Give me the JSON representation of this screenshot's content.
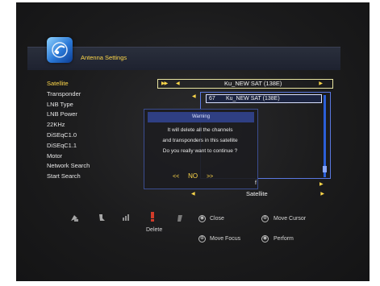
{
  "window": {
    "title": "Antenna Settings"
  },
  "menu": [
    {
      "label": "Satellite",
      "active": true
    },
    {
      "label": "Transponder",
      "active": false
    },
    {
      "label": "LNB Type",
      "active": false
    },
    {
      "label": "LNB Power",
      "active": false
    },
    {
      "label": "22KHz",
      "active": false
    },
    {
      "label": "DiSEqC1.0",
      "active": false
    },
    {
      "label": "DiSEqC1.1",
      "active": false
    },
    {
      "label": "Motor",
      "active": false
    },
    {
      "label": "Network Search",
      "active": false
    },
    {
      "label": "Start Search",
      "active": false
    }
  ],
  "satellite": {
    "value": "Ku_NEW SAT (138E)"
  },
  "satellite_list": {
    "selected_number": "67",
    "selected_name": "Ku_NEW SAT (138E)"
  },
  "network_search": {
    "value": "f"
  },
  "start_search": {
    "value": "Satellite"
  },
  "dialog": {
    "title": "Warning",
    "line1": "It will delete all the channels",
    "line2": "and transponders in this satellite",
    "line3": "Do you really want to continue ?",
    "prev": "<<",
    "selected": "NO",
    "next": ">>"
  },
  "hints": {
    "delete_label": "Delete",
    "close": "Close",
    "move_cursor": "Move Cursor",
    "move_focus": "Move Focus",
    "perform": "Perform"
  },
  "colors": {
    "highlight": "#ffd84a",
    "dialog_title_bg": "#2f3f83",
    "list_border": "#5a78e0",
    "delete_icon": "#d23c2a"
  },
  "icons": [
    "satellite-dish-icon",
    "color-key-icon",
    "red-key-icon",
    "info-icon"
  ]
}
